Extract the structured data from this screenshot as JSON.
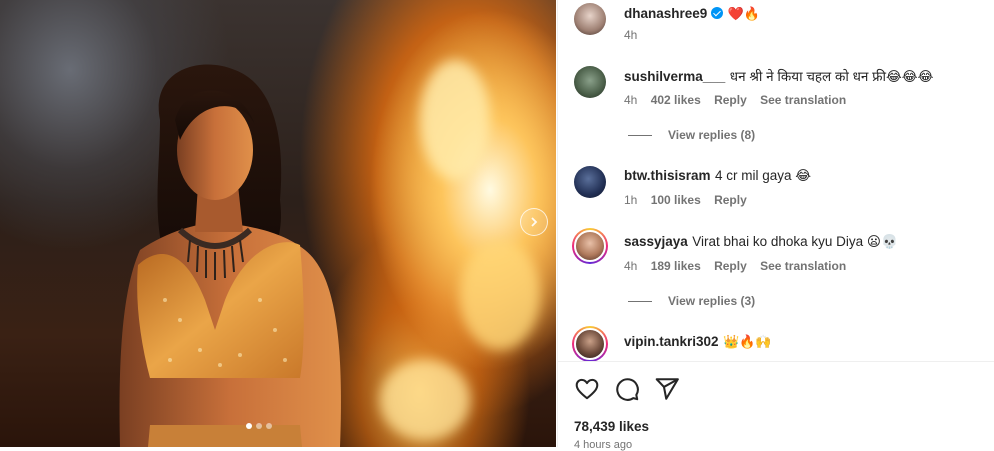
{
  "post": {
    "username": "dhanashree9",
    "caption_emojis": "❤️🔥",
    "time": "4h",
    "carousel": {
      "current_slide": 1,
      "total_slides": 3
    }
  },
  "comments": [
    {
      "username": "sushilverma___",
      "text": "धन श्री ने किया चहल को धन फ्री😂😂😂",
      "time": "4h",
      "likes": "402 likes",
      "reply": "Reply",
      "translation": "See translation",
      "view_replies": "View replies (8)"
    },
    {
      "username": "btw.thisisram",
      "text": "4 cr mil gaya 😂",
      "time": "1h",
      "likes": "100 likes",
      "reply": "Reply"
    },
    {
      "username": "sassyjaya",
      "text": "Virat bhai ko dhoka kyu Diya 😦💀",
      "time": "4h",
      "likes": "189 likes",
      "reply": "Reply",
      "translation": "See translation",
      "view_replies": "View replies (3)"
    },
    {
      "username": "vipin.tankri302",
      "text": "👑🔥🙌"
    }
  ],
  "footer": {
    "likes": "78,439 likes",
    "time": "4 hours ago"
  },
  "icons": {
    "like": "heart-icon",
    "comment": "comment-icon",
    "share": "share-icon",
    "next": "chevron-right-icon"
  }
}
